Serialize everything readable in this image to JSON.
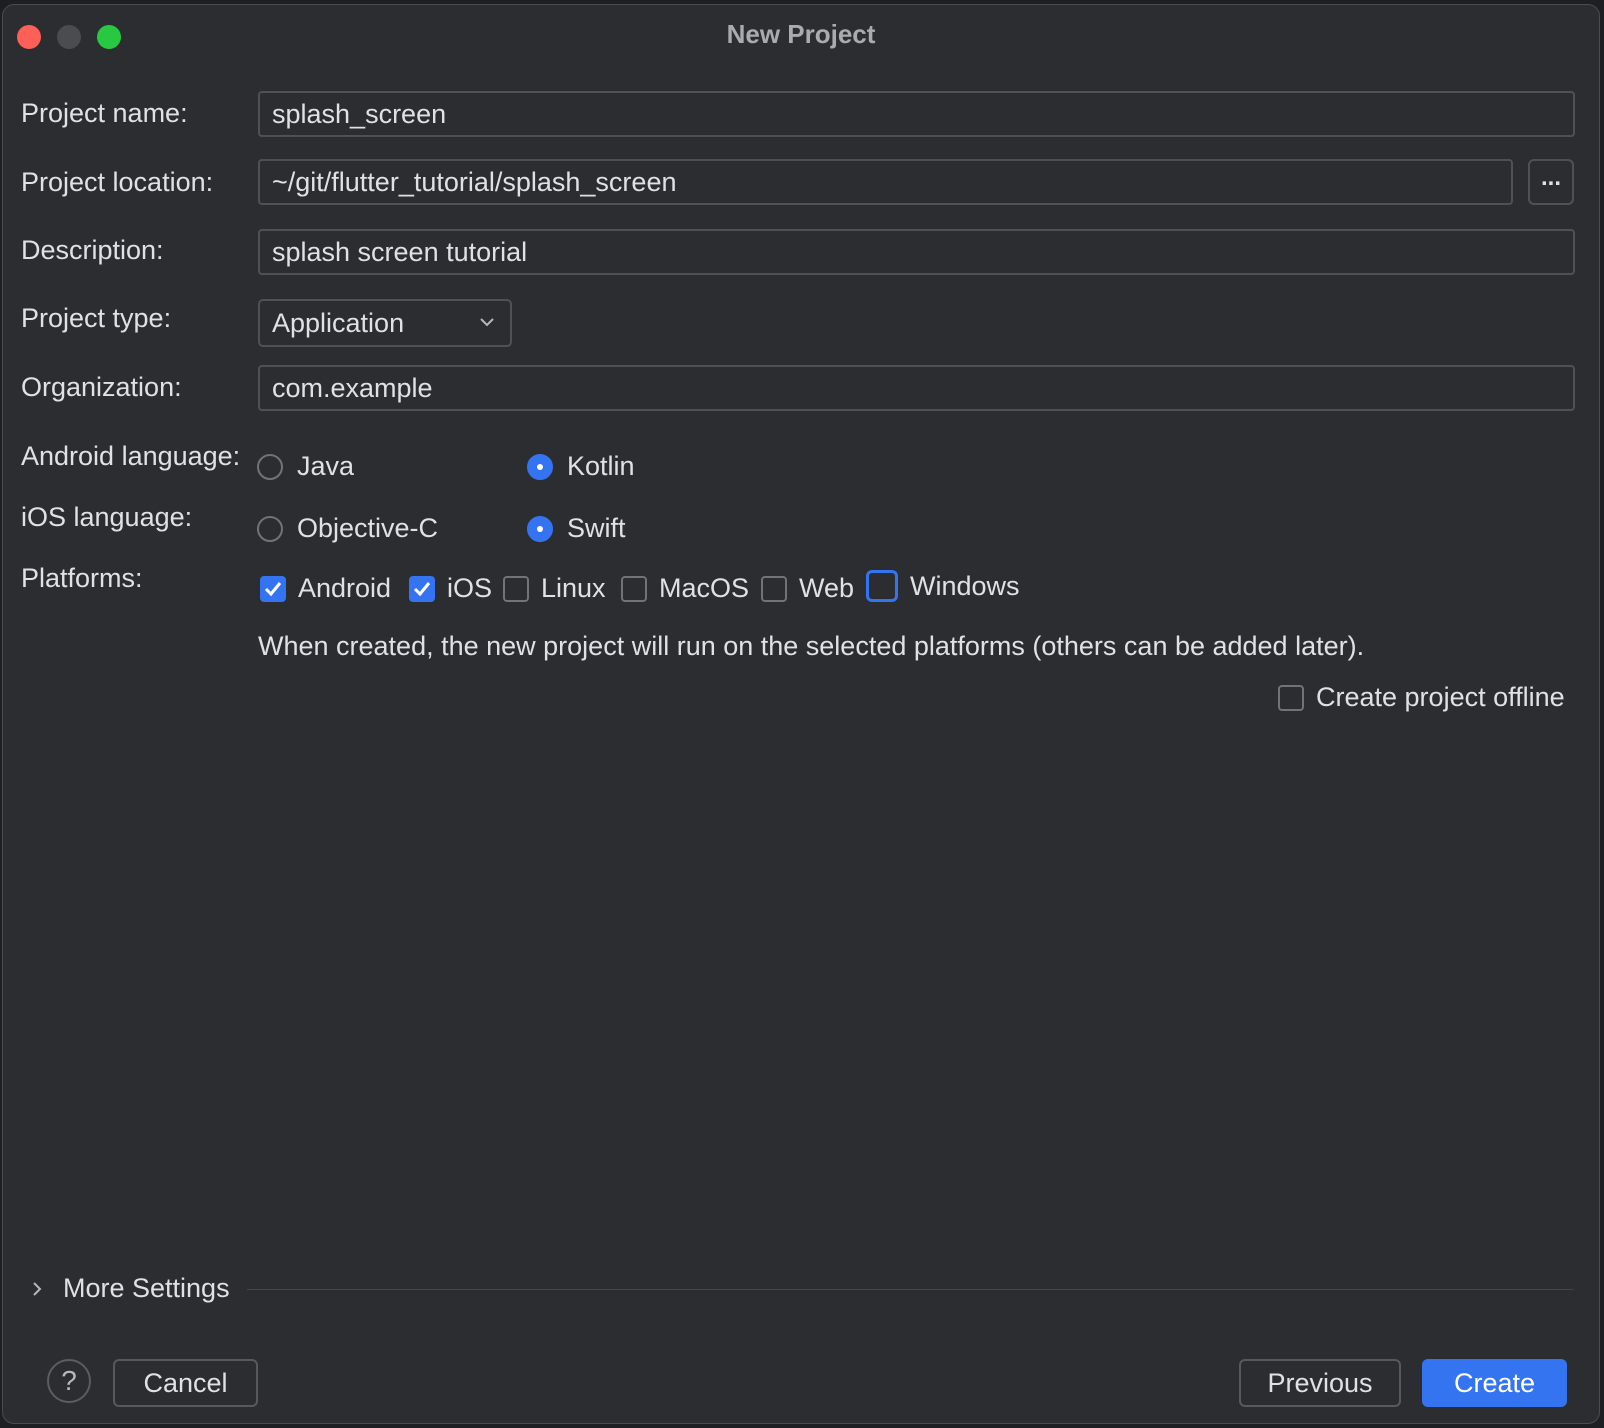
{
  "window": {
    "title": "New Project"
  },
  "form": {
    "project_name": {
      "label": "Project name:",
      "value": "splash_screen"
    },
    "project_location": {
      "label": "Project location:",
      "value": "~/git/flutter_tutorial/splash_screen",
      "browse_label": "..."
    },
    "description": {
      "label": "Description:",
      "value": "splash screen tutorial"
    },
    "project_type": {
      "label": "Project type:",
      "selected": "Application"
    },
    "organization": {
      "label": "Organization:",
      "value": "com.example"
    },
    "android_language": {
      "label": "Android language:",
      "options": [
        {
          "label": "Java",
          "selected": false
        },
        {
          "label": "Kotlin",
          "selected": true
        }
      ]
    },
    "ios_language": {
      "label": "iOS language:",
      "options": [
        {
          "label": "Objective-C",
          "selected": false
        },
        {
          "label": "Swift",
          "selected": true
        }
      ]
    },
    "platforms": {
      "label": "Platforms:",
      "options": [
        {
          "label": "Android",
          "checked": true
        },
        {
          "label": "iOS",
          "checked": true
        },
        {
          "label": "Linux",
          "checked": false
        },
        {
          "label": "MacOS",
          "checked": false
        },
        {
          "label": "Web",
          "checked": false
        },
        {
          "label": "Windows",
          "checked": false
        }
      ],
      "hint": "When created, the new project will run on the selected platforms (others can be added later)."
    },
    "offline": {
      "label": "Create project offline",
      "checked": false
    }
  },
  "more_settings": {
    "label": "More Settings"
  },
  "footer": {
    "help_label": "?",
    "cancel_label": "Cancel",
    "previous_label": "Previous",
    "create_label": "Create"
  },
  "colors": {
    "accent": "#3574f0",
    "background": "#2b2d30",
    "field_border": "#4e5157"
  }
}
